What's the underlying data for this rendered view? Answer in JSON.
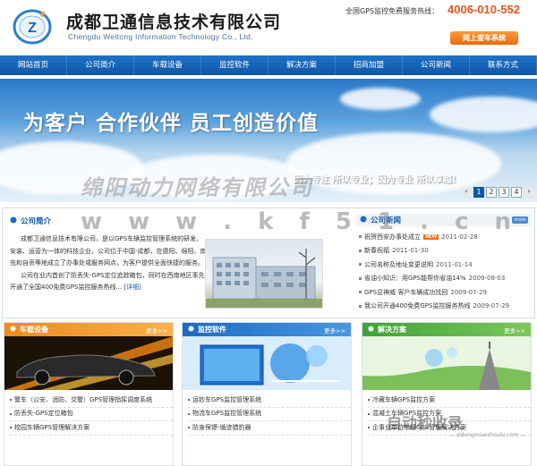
{
  "header": {
    "company_cn": "成都卫通信息技术有限公司",
    "company_en": "Chengdu Weitong Information Technology Co., Ltd.",
    "hotline_label": "全国GPS监控免费服务热线：",
    "hotline_number": "4006-010-552",
    "check_button": "网上查车系统"
  },
  "nav": {
    "items": [
      "网站首页",
      "公司简介",
      "车载设备",
      "监控软件",
      "解决方案",
      "招商加盟",
      "公司新闻",
      "联系方式"
    ]
  },
  "banner": {
    "slogan": "为客户  合作伙伴  员工创造价值",
    "sub": "因为专注  所以专业；因为专业  所以卓越！",
    "pager": [
      "1",
      "2",
      "3",
      "4"
    ],
    "active_page": "1"
  },
  "watermark": {
    "line1": "绵阳动力网络有限公司",
    "line2": "w w w . k f 5 1 . c n"
  },
  "about": {
    "title": "公司简介",
    "text1": "成都卫通信息技术有限公司，是以GPS车辆监控管理系统的研发、安装、运营为一体的科技企业，公司位于中国-成都，在德阳、绵阳、南充和自贡等地成立了办事处或服务网点，为客户提供全面快捷的服务。",
    "text2": "公司在业内首创了防丢失-GPS定位追踪箱包，同时在西南地区率先开通了全国400免费GPS监控服务热线...",
    "detail_link": "[详细]"
  },
  "news": {
    "title": "公司新闻",
    "items": [
      {
        "title": "祝贺西安办事处成立",
        "date": "2011-02-28",
        "is_new": true
      },
      {
        "title": "新春祝福",
        "date": "2011-01-30",
        "is_new": false
      },
      {
        "title": "公司名称及地址变更说明",
        "date": "2011-01-14",
        "is_new": false
      },
      {
        "title": "省油小知识：用GPS能帮你省油14%",
        "date": "2009-08-03",
        "is_new": false
      },
      {
        "title": "GPS显神威 客户车辆成功找回",
        "date": "2009-07-29",
        "is_new": false
      },
      {
        "title": "我公司开通400免费GPS监控服务热线",
        "date": "2009-07-29",
        "is_new": false
      }
    ],
    "new_tag": "NEW"
  },
  "panels": [
    {
      "title": "车载设备",
      "more": "更多>>",
      "items": [
        "警车（公安、消防、交警）GPS管理指挥调度系统",
        "防丢失-GPS定位箱包",
        "校园车辆GPS管理解决方案"
      ]
    },
    {
      "title": "监控软件",
      "more": "更多>>",
      "items": [
        "运钞车GPS监控管理系统",
        "物流车GPS监控管理系统",
        "防身保镖-循迹猎豹器"
      ]
    },
    {
      "title": "解决方案",
      "more": "更多>>",
      "items": [
        "冷藏车辆GPS监控方案",
        "混凝土车辆GPS监控方案",
        "企事业单位车辆GPS管理解决方案"
      ]
    }
  ],
  "brand_watermark": {
    "main": "自动秒收录",
    "sub": "— zidongmiaoshoulu.com —"
  },
  "colors": {
    "nav_blue": "#0d57a8",
    "hotline_orange": "#e4551d",
    "panel_orange": "#f08a1c",
    "panel_blue": "#1c6bc4",
    "panel_green": "#3ea23a"
  }
}
